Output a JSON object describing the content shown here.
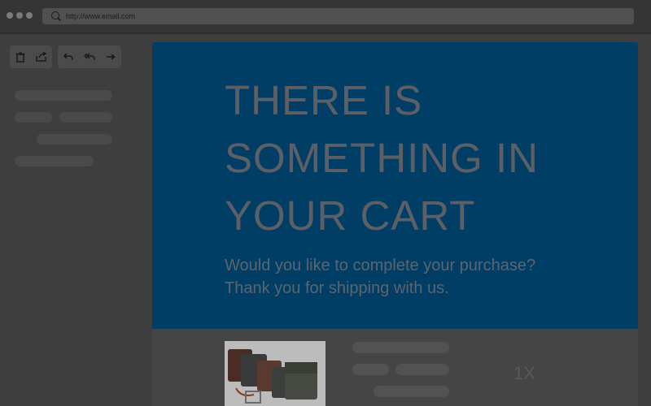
{
  "browser": {
    "url": "http://www.email.com"
  },
  "toolbar": {
    "delete_icon": "trash-icon",
    "move_icon": "move-icon",
    "reply_icon": "reply-icon",
    "reply_all_icon": "reply-all-icon",
    "forward_icon": "forward-icon"
  },
  "email": {
    "headline": "THERE IS SOMETHING IN YOUR CART",
    "sub_line1": "Would you like to complete your purchase?",
    "sub_line2": "Thank you for shipping with us.",
    "quantity": "1X"
  },
  "colors": {
    "hero": "#003e66",
    "background": "#3e3e3e"
  }
}
